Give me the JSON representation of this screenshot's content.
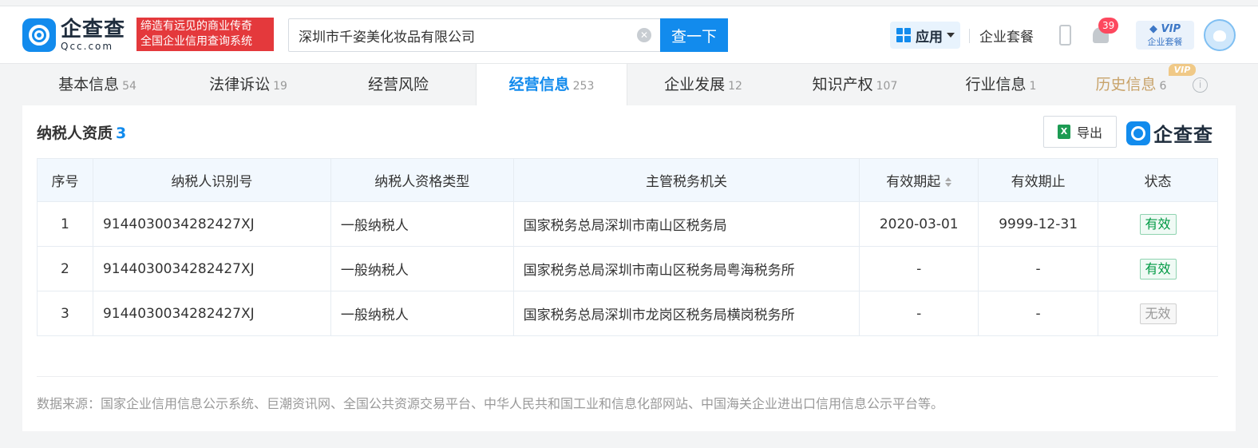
{
  "header": {
    "logo_cn": "企查查",
    "logo_en": "Qcc.com",
    "slogan_line1": "缔造有远见的商业传奇",
    "slogan_line2": "全国企业信用查询系统",
    "search_value": "深圳市千姿美化妆品有限公司",
    "search_button": "查一下",
    "apps_label": "应用",
    "package_link": "企业套餐",
    "notification_count": "39",
    "vip_top": "VIP",
    "vip_bottom": "企业套餐"
  },
  "tabs": [
    {
      "label": "基本信息",
      "count": "54"
    },
    {
      "label": "法律诉讼",
      "count": "19"
    },
    {
      "label": "经营风险",
      "count": ""
    },
    {
      "label": "经营信息",
      "count": "253"
    },
    {
      "label": "企业发展",
      "count": "12"
    },
    {
      "label": "知识产权",
      "count": "107"
    },
    {
      "label": "行业信息",
      "count": "1"
    },
    {
      "label": "历史信息",
      "count": "6"
    }
  ],
  "history_vip_tag": "VIP",
  "section": {
    "title": "纳税人资质",
    "count": "3",
    "export_label": "导出",
    "brand": "企查查"
  },
  "table": {
    "columns": [
      "序号",
      "纳税人识别号",
      "纳税人资格类型",
      "主管税务机关",
      "有效期起",
      "有效期止",
      "状态"
    ],
    "rows": [
      {
        "no": "1",
        "tax_id": "9144030034282427XJ",
        "type": "一般纳税人",
        "authority": "国家税务总局深圳市南山区税务局",
        "start": "2020-03-01",
        "end": "9999-12-31",
        "status": "有效"
      },
      {
        "no": "2",
        "tax_id": "9144030034282427XJ",
        "type": "一般纳税人",
        "authority": "国家税务总局深圳市南山区税务局粤海税务所",
        "start": "-",
        "end": "-",
        "status": "有效"
      },
      {
        "no": "3",
        "tax_id": "9144030034282427XJ",
        "type": "一般纳税人",
        "authority": "国家税务总局深圳市龙岗区税务局横岗税务所",
        "start": "-",
        "end": "-",
        "status": "无效"
      }
    ]
  },
  "footer": {
    "source": "数据来源：国家企业信用信息公示系统、巨潮资讯网、全国公共资源交易平台、中华人民共和国工业和信息化部网站、中国海关企业进出口信用信息公示平台等。"
  },
  "colors": {
    "brand_blue": "#128bed",
    "slogan_red": "#e4393c",
    "valid_green": "#009944",
    "history_gold": "#c8a36a"
  }
}
